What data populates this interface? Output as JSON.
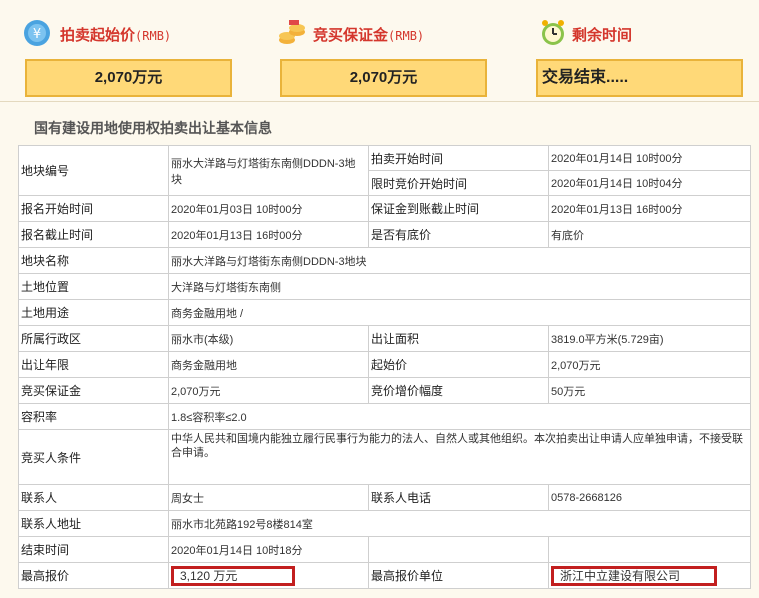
{
  "header": {
    "start_price": {
      "label": "拍卖起始价",
      "unit": "(RMB)",
      "value": "2,070万元",
      "icon": "money-icon"
    },
    "deposit": {
      "label": "竞买保证金",
      "unit": "(RMB)",
      "value": "2,070万元",
      "icon": "coins-icon"
    },
    "remaining": {
      "label": "剩余时间",
      "value": "交易结束.....",
      "icon": "alarm-clock-icon"
    }
  },
  "section_title": "国有建设用地使用权拍卖出让基本信息",
  "info": {
    "parcel_no_label": "地块编号",
    "parcel_no": "丽水大洋路与灯塔街东南侧DDDN-3地块",
    "auction_start_label": "拍卖开始时间",
    "auction_start": "2020年01月14日 10时00分",
    "limit_bid_start_label": "限时竞价开始时间",
    "limit_bid_start": "2020年01月14日 10时04分",
    "reg_start_label": "报名开始时间",
    "reg_start": "2020年01月03日 10时00分",
    "deposit_deadline_label": "保证金到账截止时间",
    "deposit_deadline": "2020年01月13日 16时00分",
    "reg_end_label": "报名截止时间",
    "reg_end": "2020年01月13日 16时00分",
    "reserve_label": "是否有底价",
    "reserve": "有底价",
    "parcel_name_label": "地块名称",
    "parcel_name": "丽水大洋路与灯塔街东南侧DDDN-3地块",
    "location_label": "土地位置",
    "location": "大洋路与灯塔街东南侧",
    "usage_label": "土地用途",
    "usage": "商务金融用地 /",
    "district_label": "所属行政区",
    "district": "丽水市(本级)",
    "area_label": "出让面积",
    "area": "3819.0平方米(5.729亩)",
    "term_label": "出让年限",
    "term": "商务金融用地",
    "start_price_label": "起始价",
    "start_price": "2,070万元",
    "deposit_label": "竞买保证金",
    "deposit": "2,070万元",
    "increment_label": "竞价增价幅度",
    "increment": "50万元",
    "far_label": "容积率",
    "far": "1.8≤容积率≤2.0",
    "bidder_cond_label": "竞买人条件",
    "bidder_cond": "中华人民共和国境内能独立履行民事行为能力的法人、自然人或其他组织。本次拍卖出让申请人应单独申请，不接受联合申请。",
    "contact_label": "联系人",
    "contact": "周女士",
    "phone_label": "联系人电话",
    "phone": "0578-2668126",
    "address_label": "联系人地址",
    "address": "丽水市北苑路192号8楼814室",
    "end_time_label": "结束时间",
    "end_time": "2020年01月14日 10时18分",
    "top_bid_label": "最高报价",
    "top_bid": "3,120 万元",
    "top_bidder_label": "最高报价单位",
    "top_bidder": "浙江中立建设有限公司"
  }
}
